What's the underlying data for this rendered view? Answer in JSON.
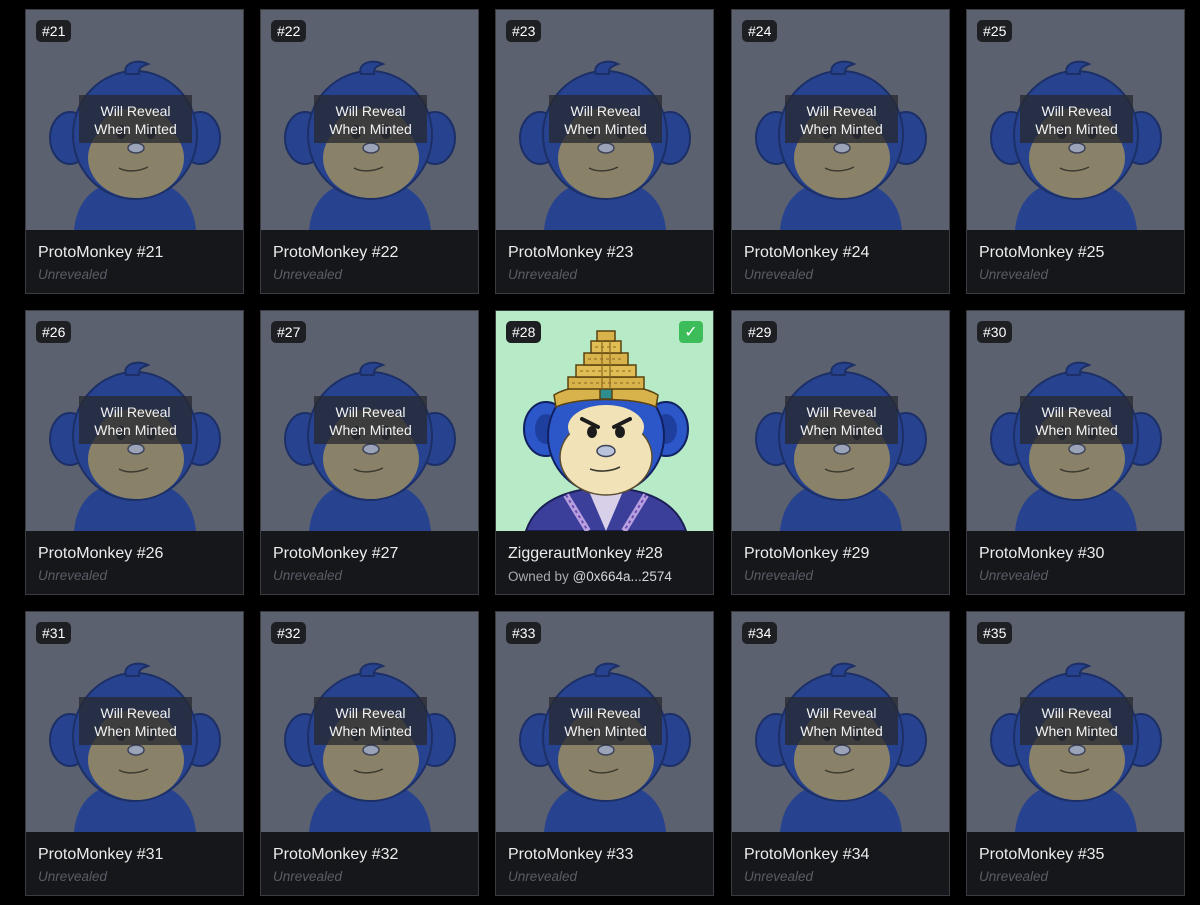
{
  "placeholder": {
    "overlay_line1": "Will Reveal",
    "overlay_line2": "When Minted",
    "status": "Unrevealed",
    "bg_color": "#5c6170",
    "monkey_color": "#27438f"
  },
  "cards": [
    {
      "badge": "#21",
      "title": "ProtoMonkey #21",
      "revealed": false
    },
    {
      "badge": "#22",
      "title": "ProtoMonkey #22",
      "revealed": false
    },
    {
      "badge": "#23",
      "title": "ProtoMonkey #23",
      "revealed": false
    },
    {
      "badge": "#24",
      "title": "ProtoMonkey #24",
      "revealed": false
    },
    {
      "badge": "#25",
      "title": "ProtoMonkey #25",
      "revealed": false
    },
    {
      "badge": "#26",
      "title": "ProtoMonkey #26",
      "revealed": false
    },
    {
      "badge": "#27",
      "title": "ProtoMonkey #27",
      "revealed": false
    },
    {
      "badge": "#28",
      "title": "ZiggerautMonkey #28",
      "revealed": true,
      "owned_prefix": "Owned by",
      "owner": "@0x664a...2574",
      "check": "✓",
      "bg_color": "#b7ebc8"
    },
    {
      "badge": "#29",
      "title": "ProtoMonkey #29",
      "revealed": false
    },
    {
      "badge": "#30",
      "title": "ProtoMonkey #30",
      "revealed": false
    },
    {
      "badge": "#31",
      "title": "ProtoMonkey #31",
      "revealed": false
    },
    {
      "badge": "#32",
      "title": "ProtoMonkey #32",
      "revealed": false
    },
    {
      "badge": "#33",
      "title": "ProtoMonkey #33",
      "revealed": false
    },
    {
      "badge": "#34",
      "title": "ProtoMonkey #34",
      "revealed": false
    },
    {
      "badge": "#35",
      "title": "ProtoMonkey #35",
      "revealed": false
    }
  ]
}
